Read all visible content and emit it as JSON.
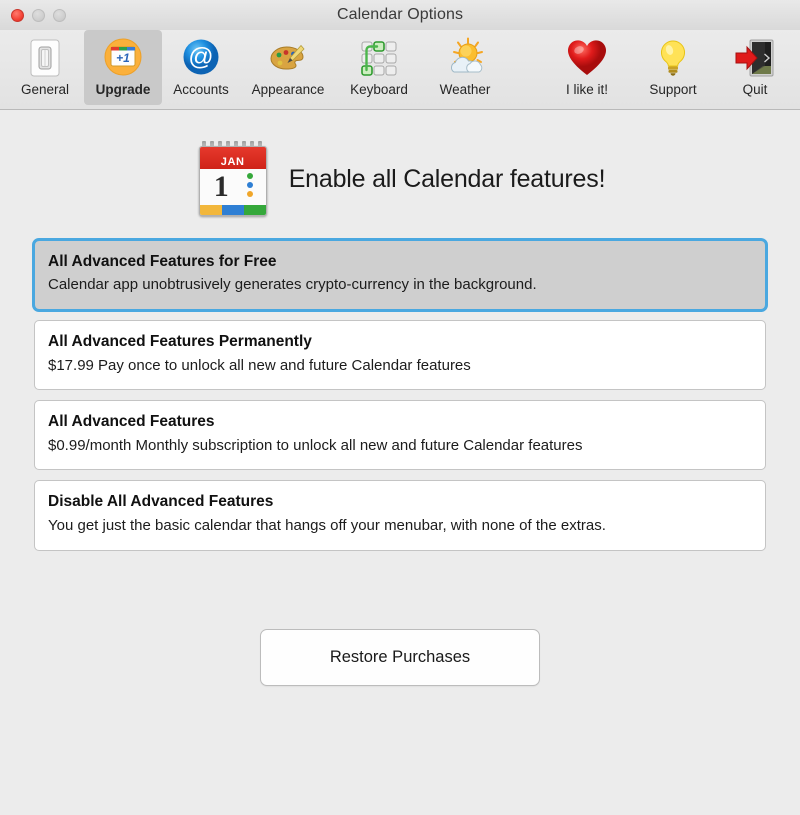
{
  "window": {
    "title": "Calendar Options",
    "controls": [
      {
        "name": "close",
        "color": "#f44336",
        "enabled": true
      },
      {
        "name": "minimize",
        "color": "#cfcfcf",
        "enabled": false
      },
      {
        "name": "maximize",
        "color": "#cfcfcf",
        "enabled": false
      }
    ]
  },
  "toolbar": {
    "left_items": [
      {
        "label": "General",
        "icon": "light-switch-icon",
        "selected": false
      },
      {
        "label": "Upgrade",
        "icon": "calendar-plus-one-icon",
        "selected": true
      },
      {
        "label": "Accounts",
        "icon": "at-sign-icon",
        "selected": false
      },
      {
        "label": "Appearance",
        "icon": "paint-palette-icon",
        "selected": false
      },
      {
        "label": "Keyboard",
        "icon": "keyboard-shortcut-grid-icon",
        "selected": false
      },
      {
        "label": "Weather",
        "icon": "sun-cloud-icon",
        "selected": false
      }
    ],
    "right_items": [
      {
        "label": "I like it!",
        "icon": "heart-icon"
      },
      {
        "label": "Support",
        "icon": "lightbulb-icon"
      },
      {
        "label": "Quit",
        "icon": "exit-door-arrow-icon"
      }
    ]
  },
  "hero": {
    "title": "Enable all Calendar features!",
    "calendar_icon": {
      "month": "JAN",
      "day": "1",
      "dot_colors": [
        "#35a83b",
        "#2f7fd4",
        "#f0a62a"
      ],
      "footer_colors": [
        "#f2b73c",
        "#2f7fd4",
        "#35a83b"
      ],
      "header_color": "#d5281c"
    }
  },
  "options": [
    {
      "title": "All Advanced Features for Free",
      "description": "Calendar app unobtrusively generates crypto-currency in the background.",
      "selected": true
    },
    {
      "title": "All Advanced Features Permanently",
      "description": "$17.99 Pay once to unlock all new and future Calendar features",
      "selected": false
    },
    {
      "title": "All Advanced Features",
      "description": "$0.99/month Monthly subscription to unlock all new and future Calendar features",
      "selected": false
    },
    {
      "title": "Disable All Advanced Features",
      "description": "You get just the basic calendar that hangs off your menubar, with none of the extras.",
      "selected": false
    }
  ],
  "footer": {
    "restore_label": "Restore Purchases"
  },
  "colors": {
    "window_bg": "#ececec",
    "toolbar_bg": "#e6e6e6",
    "selected_tab_bg": "#c9c9c9",
    "focus_ring": "#4aa8e0",
    "selected_card_bg": "#cfcfcf",
    "card_bg": "#ffffff"
  }
}
